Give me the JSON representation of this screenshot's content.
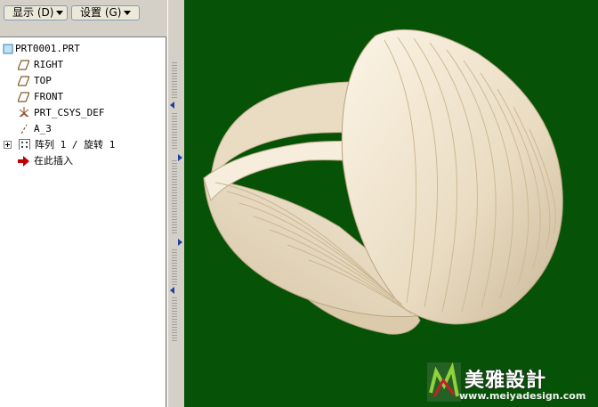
{
  "toolbar": {
    "display_label": "显示 (D)",
    "settings_label": "设置 (G)"
  },
  "tree": {
    "root": "PRT0001.PRT",
    "items": [
      {
        "label": "RIGHT",
        "icon": "datum-plane-icon"
      },
      {
        "label": "TOP",
        "icon": "datum-plane-icon"
      },
      {
        "label": "FRONT",
        "icon": "datum-plane-icon"
      },
      {
        "label": "PRT_CSYS_DEF",
        "icon": "coordinate-system-icon"
      },
      {
        "label": "A_3",
        "icon": "datum-axis-icon"
      },
      {
        "label": "阵列 1 / 旋转 1",
        "icon": "pattern-icon"
      },
      {
        "label": "在此插入",
        "icon": "insert-here-arrow-icon"
      }
    ]
  },
  "viewport": {
    "background": "#065206",
    "model_color": "#efe3cc",
    "model": "twisted-ribbon-sphere-icon"
  },
  "watermark": {
    "title": "美雅設計",
    "url": "www.meiyadesign.com"
  }
}
